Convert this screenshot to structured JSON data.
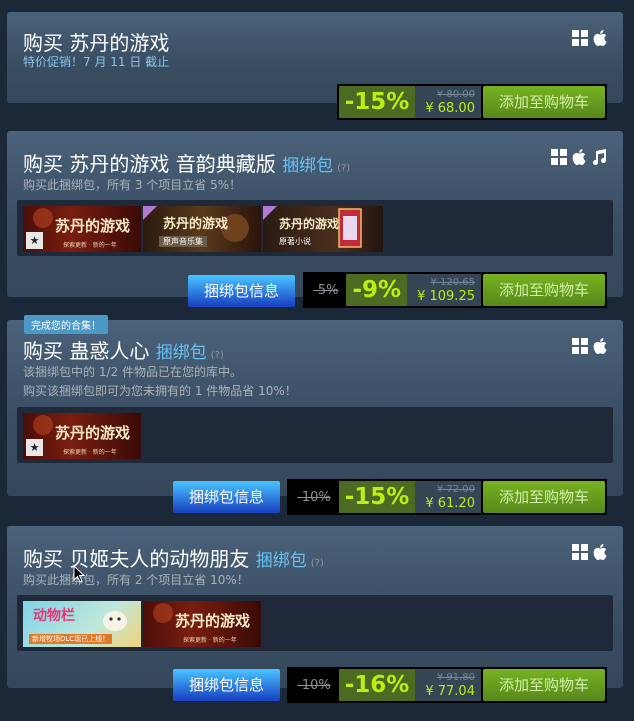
{
  "main_purchase": {
    "title": "购买 苏丹的游戏",
    "promo": "特价促销！7 月 11 日 截止",
    "discount": "-15%",
    "original_price": "¥ 80.00",
    "final_price": "¥ 68.00",
    "cart_label": "添加至购物车"
  },
  "bundles": [
    {
      "title": "购买 苏丹的游戏 音韵典藏版",
      "bundle_word": "捆绑包",
      "help": "(?)",
      "desc": "购买此捆绑包，所有 3 个项目立省 5%！",
      "info_label": "捆绑包信息",
      "bundle_discount": "-5%",
      "discount": "-9%",
      "original_price": "¥ 120.65",
      "final_price": "¥ 109.25",
      "cart_label": "添加至购物车",
      "items": [
        "苏丹的游戏",
        "原声音乐集",
        "原著小说"
      ]
    },
    {
      "badge": "完成您的合集！",
      "title": "购买 蛊惑人心",
      "bundle_word": "捆绑包",
      "help": "(?)",
      "desc_line1": "该捆绑包中的 1/2 件物品已在您的库中。",
      "desc_line2": "购买该捆绑包即可为您未拥有的 1 件物品省 10%！",
      "info_label": "捆绑包信息",
      "bundle_discount": "-10%",
      "discount": "-15%",
      "original_price": "¥ 72.00",
      "final_price": "¥ 61.20",
      "cart_label": "添加至购物车",
      "items": [
        "苏丹的游戏"
      ]
    },
    {
      "title": "购买 贝姬夫人的动物朋友",
      "bundle_word": "捆绑包",
      "help": "(?)",
      "desc": "购买此捆绑包，所有 2 个项目立省 10%！",
      "info_label": "捆绑包信息",
      "bundle_discount": "-10%",
      "discount": "-16%",
      "original_price": "¥ 91.80",
      "final_price": "¥ 77.04",
      "cart_label": "添加至购物车",
      "items": [
        "动物栏",
        "苏丹的游戏"
      ]
    }
  ],
  "capsule_texts": {
    "sultan_sub": "探索更新 · 新的一年",
    "ost_banner": "原声音乐集",
    "novel_banner": "原著小说",
    "animal_title": "动物栏",
    "animal_sub": "新增牧场DLC现已上线！"
  },
  "icons": [
    "windows-icon",
    "apple-icon",
    "music-icon",
    "star-icon",
    "cursor-icon"
  ],
  "colors": {
    "background": "#1b2838",
    "discount_green": "#beee11",
    "cart_green": "#75b022",
    "info_blue": "#47bfff"
  }
}
